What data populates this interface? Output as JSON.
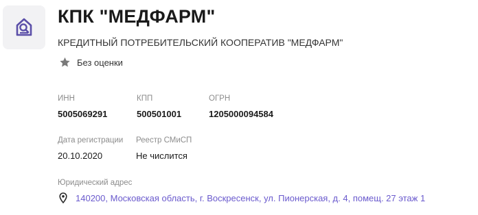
{
  "company": {
    "short_name": "КПК \"МЕДФАРМ\"",
    "full_name": "КРЕДИТНЫЙ ПОТРЕБИТЕЛЬСКИЙ КООПЕРАТИВ \"МЕДФАРМ\"",
    "logo_icon": "document-search-icon"
  },
  "rating": {
    "icon": "star-icon",
    "text": "Без оценки",
    "color": "#7a7a7a"
  },
  "requisites": {
    "inn": {
      "label": "ИНН",
      "value": "5005069291"
    },
    "kpp": {
      "label": "КПП",
      "value": "500501001"
    },
    "ogrn": {
      "label": "ОГРН",
      "value": "1205000094584"
    }
  },
  "registration": {
    "date": {
      "label": "Дата регистрации",
      "value": "20.10.2020"
    },
    "smsp": {
      "label": "Реестр СМиСП",
      "value": "Не числится"
    }
  },
  "address": {
    "label": "Юридический адрес",
    "icon": "location-pin-icon",
    "value": "140200, Московская область, г. Воскресенск, ул. Пионерская, д. 4, помещ. 27 этаж 1",
    "link_color": "#6a5acd"
  },
  "colors": {
    "logo_bg": "#f2f2f4",
    "logo_fg": "#5b4fa8",
    "accent": "#6a5acd",
    "muted": "#8c8c8c"
  }
}
